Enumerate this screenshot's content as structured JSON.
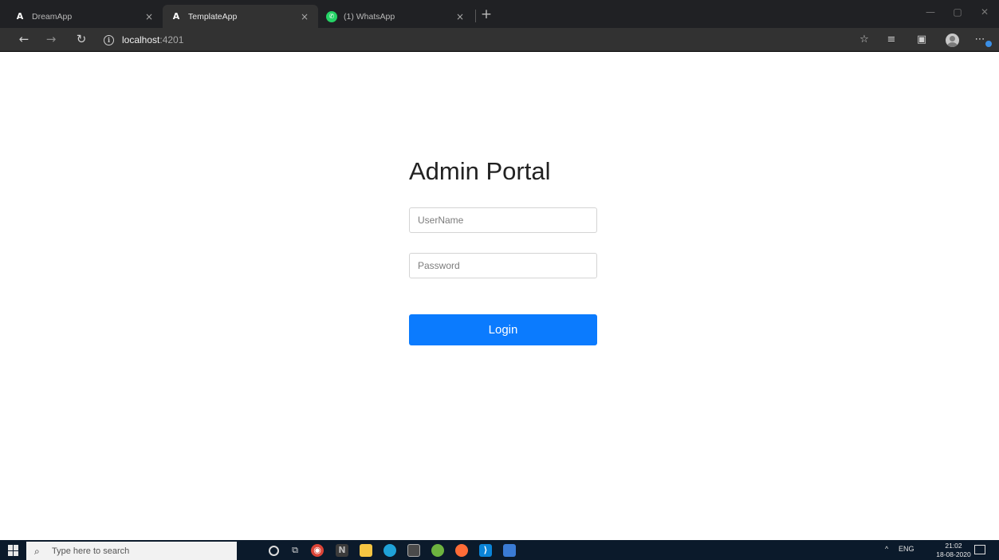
{
  "browser": {
    "tabs": [
      {
        "label": "DreamApp",
        "icon": "angular-icon",
        "close": "×"
      },
      {
        "label": "TemplateApp",
        "icon": "angular-icon",
        "close": "×"
      },
      {
        "label": "(1) WhatsApp",
        "icon": "whatsapp-icon",
        "close": "×"
      }
    ],
    "new_tab": "+",
    "window_controls": {
      "minimize": "—",
      "maximize": "▢",
      "close": "✕"
    },
    "nav": {
      "back": "←",
      "forward": "→",
      "refresh": "↻"
    },
    "url_host": "localhost",
    "url_port": ":4201",
    "toolbar_icons": {
      "favorite": "☆",
      "favorites_bar": "≡",
      "collections": "▣",
      "more": "⋯"
    }
  },
  "page": {
    "title": "Admin Portal",
    "username_placeholder": "UserName",
    "password_placeholder": "Password",
    "login_label": "Login"
  },
  "taskbar": {
    "search_placeholder": "Type here to search",
    "tray_language": "ENG",
    "tray_chevron": "^",
    "time": "21:02",
    "date": "18-08-2020",
    "apps": [
      {
        "name": "cortana",
        "color": "#0b1a2b"
      },
      {
        "name": "task-view",
        "color": "#0b1a2b"
      },
      {
        "name": "chrome",
        "color": "#f4b400"
      },
      {
        "name": "onenote",
        "color": "#3b3b3b"
      },
      {
        "name": "file-explorer",
        "color": "#f5c542"
      },
      {
        "name": "edge",
        "color": "#1fa2d8"
      },
      {
        "name": "terminal",
        "color": "#4a4a4a"
      },
      {
        "name": "spring",
        "color": "#6db33f"
      },
      {
        "name": "postman",
        "color": "#ff6c37"
      },
      {
        "name": "vscode",
        "color": "#0a84d8"
      },
      {
        "name": "azure-data",
        "color": "#3a7bd5"
      }
    ]
  }
}
